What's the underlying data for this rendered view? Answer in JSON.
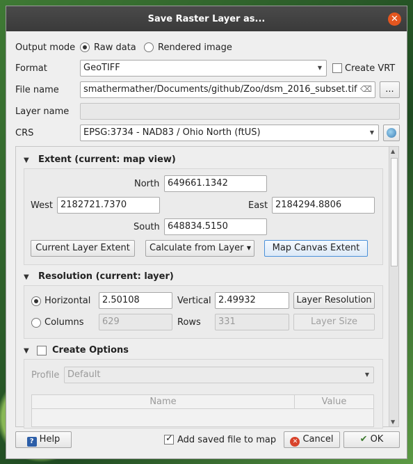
{
  "window": {
    "title": "Save Raster Layer as...",
    "close_label": "✕"
  },
  "output_mode": {
    "label": "Output mode",
    "options": [
      {
        "label": "Raw data",
        "selected": true
      },
      {
        "label": "Rendered image",
        "selected": false
      }
    ]
  },
  "format": {
    "label": "Format",
    "value": "GeoTIFF",
    "create_vrt_label": "Create VRT",
    "create_vrt_checked": false
  },
  "file_name": {
    "label": "File name",
    "value": "smathermather/Documents/github/Zoo/dsm_2016_subset.tif",
    "clear_icon": "⌫",
    "browse_label": "..."
  },
  "layer_name": {
    "label": "Layer name",
    "value": ""
  },
  "crs": {
    "label": "CRS",
    "value": "EPSG:3734 - NAD83 / Ohio North (ftUS)"
  },
  "extent": {
    "title": "Extent (current: map view)",
    "north_label": "North",
    "north": "649661.1342",
    "west_label": "West",
    "west": "2182721.7370",
    "east_label": "East",
    "east": "2184294.8806",
    "south_label": "South",
    "south": "648834.5150",
    "current_layer_btn": "Current Layer Extent",
    "calculate_btn": "Calculate from Layer",
    "map_canvas_btn": "Map Canvas Extent"
  },
  "resolution": {
    "title": "Resolution (current: layer)",
    "horizontal_label": "Horizontal",
    "horizontal": "2.50108",
    "vertical_label": "Vertical",
    "vertical": "2.49932",
    "layer_resolution_btn": "Layer Resolution",
    "columns_label": "Columns",
    "columns": "629",
    "rows_label": "Rows",
    "rows": "331",
    "layer_size_btn": "Layer Size"
  },
  "create_options": {
    "title": "Create Options",
    "profile_label": "Profile",
    "profile_value": "Default",
    "columns": [
      "Name",
      "Value"
    ]
  },
  "footer": {
    "help_label": "Help",
    "add_to_map_label": "Add saved file to map",
    "add_to_map_checked": true,
    "cancel_label": "Cancel",
    "ok_label": "OK"
  },
  "colors": {
    "titlebar": "#3a3a3a",
    "close": "#e4561f",
    "focus": "#4a90d9"
  }
}
